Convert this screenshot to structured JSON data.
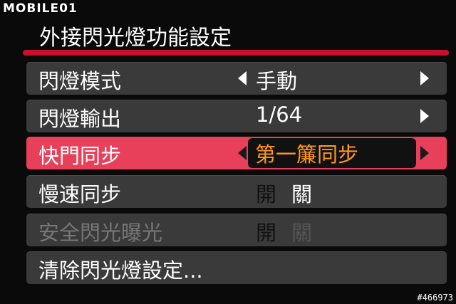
{
  "watermark": "MOBILE01",
  "header": {
    "title": "外接閃光燈功能設定"
  },
  "menu": {
    "items": [
      {
        "label": "閃燈模式",
        "value": "手動"
      },
      {
        "label": "閃燈輸出",
        "value": "1/64"
      },
      {
        "label": "快門同步",
        "value": "第一簾同步"
      },
      {
        "label": "慢速同步",
        "on": "開",
        "off": "關"
      },
      {
        "label": "安全閃光曝光",
        "on": "開",
        "off": "關"
      },
      {
        "label": "清除閃光燈設定..."
      }
    ],
    "selected_index": 2
  },
  "footer": {
    "id": "#466973"
  },
  "colors": {
    "accent": "#c8102e",
    "selected_row": "#e8405a",
    "selected_value": "#ff9a1a",
    "row_bg": "#3a3a3a"
  }
}
